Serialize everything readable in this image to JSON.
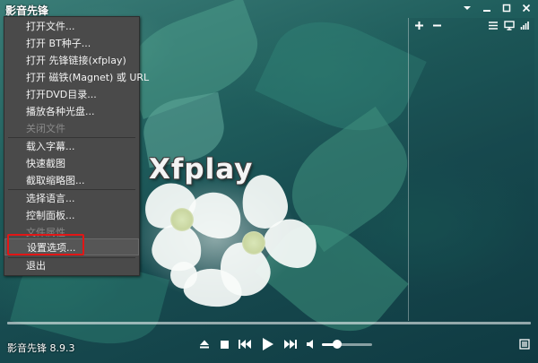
{
  "app": {
    "title": "影音先锋",
    "logo_text": "Xfplay",
    "status": "影音先锋 8.9.3"
  },
  "window_controls": {
    "menu_icon": "dropdown-arrow-icon",
    "minimize_icon": "minimize-icon",
    "maximize_icon": "maximize-icon",
    "close_icon": "close-icon"
  },
  "context_menu": {
    "items": [
      {
        "label": "打开文件...",
        "enabled": true
      },
      {
        "label": "打开 BT种子...",
        "enabled": true
      },
      {
        "label": "打开 先锋链接(xfplay)",
        "enabled": true
      },
      {
        "label": "打开 磁铁(Magnet) 或 URL",
        "enabled": true
      },
      {
        "label": "打开DVD目录...",
        "enabled": true
      },
      {
        "label": "播放各种光盘...",
        "enabled": true
      },
      {
        "label": "关闭文件",
        "enabled": false
      },
      {
        "label": "载入字幕...",
        "enabled": true
      },
      {
        "label": "快速截图",
        "enabled": true
      },
      {
        "label": "截取缩略图...",
        "enabled": true
      },
      {
        "label": "选择语言...",
        "enabled": true
      },
      {
        "label": "控制面板...",
        "enabled": true
      },
      {
        "label": "文件属性...",
        "enabled": false
      },
      {
        "label": "设置选项...",
        "enabled": true,
        "highlighted": true
      },
      {
        "label": "退出",
        "enabled": true
      }
    ]
  },
  "playlist": {
    "toolbar": [
      "plus-icon",
      "minus-icon",
      "list-icon",
      "monitor-icon",
      "signal-bars-icon"
    ]
  },
  "controls": {
    "icons": [
      "eject-icon",
      "stop-icon",
      "previous-icon",
      "play-icon",
      "next-icon",
      "volume-icon",
      "playlist-menu-icon"
    ],
    "volume_level": 0.3
  },
  "colors": {
    "menu_bg": "#4a4a4a",
    "highlight_box": "#e21616"
  }
}
